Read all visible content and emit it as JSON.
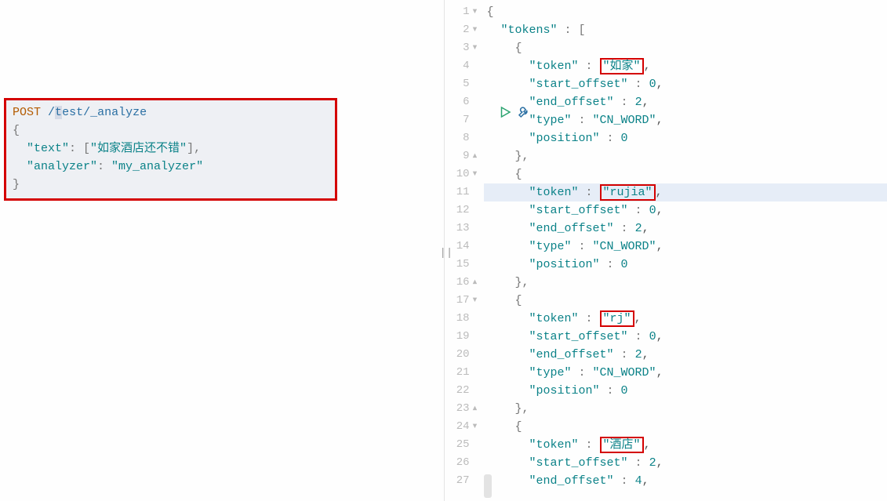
{
  "request": {
    "method": "POST",
    "path_before": "/",
    "path_sel": "t",
    "path_after": "est",
    "path_tail": "/_analyze",
    "line_open": "{",
    "l_text_key": "\"text\"",
    "l_text_colon": ": [",
    "l_text_val": "\"如家酒店还不错\"",
    "l_text_end": "],",
    "l_analyzer_key": "\"analyzer\"",
    "l_analyzer_colon": ": ",
    "l_analyzer_val": "\"my_analyzer\"",
    "line_close": "}"
  },
  "icons": {
    "run": "run-icon",
    "wrench": "wrench-icon"
  },
  "response_lines": [
    {
      "ln": "1",
      "fold": "▾",
      "indent": 0,
      "txt_brace_open": "{"
    },
    {
      "ln": "2",
      "fold": "▾",
      "indent": 1,
      "key": "\"tokens\"",
      "mid": " : [",
      "tail": ""
    },
    {
      "ln": "3",
      "fold": "▾",
      "indent": 2,
      "txt_brace_open": "{"
    },
    {
      "ln": "4",
      "indent": 3,
      "key": "\"token\"",
      "mid": " : ",
      "valbox": "\"如家\"",
      "tail": ","
    },
    {
      "ln": "5",
      "indent": 3,
      "key": "\"start_offset\"",
      "mid": " : ",
      "valnum": "0",
      "tail": ","
    },
    {
      "ln": "6",
      "indent": 3,
      "key": "\"end_offset\"",
      "mid": " : ",
      "valnum": "2",
      "tail": ","
    },
    {
      "ln": "7",
      "indent": 3,
      "key": "\"type\"",
      "mid": " : ",
      "valstr": "\"CN_WORD\"",
      "tail": ","
    },
    {
      "ln": "8",
      "indent": 3,
      "key": "\"position\"",
      "mid": " : ",
      "valnum": "0",
      "tail": ""
    },
    {
      "ln": "9",
      "fold": "▴",
      "indent": 2,
      "txt_brace_close": "},",
      "tail": ""
    },
    {
      "ln": "10",
      "fold": "▾",
      "indent": 2,
      "txt_brace_open": "{"
    },
    {
      "ln": "11",
      "hl": true,
      "indent": 3,
      "key": "\"token\"",
      "mid": " : ",
      "valbox": "\"rujia\"",
      "tail": ","
    },
    {
      "ln": "12",
      "indent": 3,
      "key": "\"start_offset\"",
      "mid": " : ",
      "valnum": "0",
      "tail": ","
    },
    {
      "ln": "13",
      "indent": 3,
      "key": "\"end_offset\"",
      "mid": " : ",
      "valnum": "2",
      "tail": ","
    },
    {
      "ln": "14",
      "indent": 3,
      "key": "\"type\"",
      "mid": " : ",
      "valstr": "\"CN_WORD\"",
      "tail": ","
    },
    {
      "ln": "15",
      "indent": 3,
      "key": "\"position\"",
      "mid": " : ",
      "valnum": "0",
      "tail": ""
    },
    {
      "ln": "16",
      "fold": "▴",
      "indent": 2,
      "txt_brace_close": "},",
      "tail": ""
    },
    {
      "ln": "17",
      "fold": "▾",
      "indent": 2,
      "txt_brace_open": "{"
    },
    {
      "ln": "18",
      "indent": 3,
      "key": "\"token\"",
      "mid": " : ",
      "valbox": "\"rj\"",
      "tail": ","
    },
    {
      "ln": "19",
      "indent": 3,
      "key": "\"start_offset\"",
      "mid": " : ",
      "valnum": "0",
      "tail": ","
    },
    {
      "ln": "20",
      "indent": 3,
      "key": "\"end_offset\"",
      "mid": " : ",
      "valnum": "2",
      "tail": ","
    },
    {
      "ln": "21",
      "indent": 3,
      "key": "\"type\"",
      "mid": " : ",
      "valstr": "\"CN_WORD\"",
      "tail": ","
    },
    {
      "ln": "22",
      "indent": 3,
      "key": "\"position\"",
      "mid": " : ",
      "valnum": "0",
      "tail": ""
    },
    {
      "ln": "23",
      "fold": "▴",
      "indent": 2,
      "txt_brace_close": "},",
      "tail": ""
    },
    {
      "ln": "24",
      "fold": "▾",
      "indent": 2,
      "txt_brace_open": "{"
    },
    {
      "ln": "25",
      "indent": 3,
      "key": "\"token\"",
      "mid": " : ",
      "valbox": "\"酒店\"",
      "tail": ","
    },
    {
      "ln": "26",
      "indent": 3,
      "key": "\"start_offset\"",
      "mid": " : ",
      "valnum": "2",
      "tail": ","
    },
    {
      "ln": "27",
      "indent": 3,
      "key": "\"end_offset\"",
      "mid": " : ",
      "valnum": "4",
      "tail": ","
    }
  ]
}
